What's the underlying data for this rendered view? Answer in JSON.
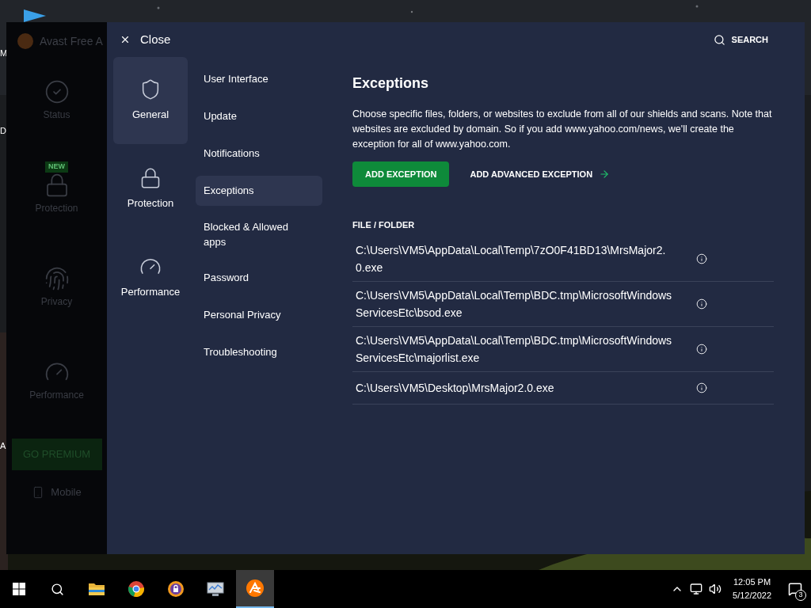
{
  "desktop": {
    "icon_labels": [
      "M",
      "D",
      "A"
    ]
  },
  "app": {
    "title": "Avast Free A",
    "sidebar": [
      {
        "kind": "status",
        "label": "Status"
      },
      {
        "kind": "protection",
        "label": "Protection",
        "badge": "NEW"
      },
      {
        "kind": "privacy",
        "label": "Privacy"
      },
      {
        "kind": "performance",
        "label": "Performance"
      }
    ],
    "premium_button": "GO PREMIUM",
    "mobile": "Mobile"
  },
  "settings": {
    "close": "Close",
    "search": "SEARCH",
    "categories": [
      {
        "kind": "general",
        "label": "General",
        "selected": true
      },
      {
        "kind": "protection",
        "label": "Protection",
        "selected": false
      },
      {
        "kind": "performance",
        "label": "Performance",
        "selected": false
      }
    ],
    "subnav": [
      {
        "label": "User Interface",
        "selected": false
      },
      {
        "label": "Update",
        "selected": false
      },
      {
        "label": "Notifications",
        "selected": false
      },
      {
        "label": "Exceptions",
        "selected": true
      },
      {
        "label": "Blocked & Allowed apps",
        "selected": false
      },
      {
        "label": "Password",
        "selected": false
      },
      {
        "label": "Personal Privacy",
        "selected": false
      },
      {
        "label": "Troubleshooting",
        "selected": false
      }
    ],
    "heading": "Exceptions",
    "description": "Choose specific files, folders, or websites to exclude from all of our shields and scans. Note that websites are excluded by domain. So if you add www.yahoo.com/news, we'll create the exception for all of www.yahoo.com.",
    "add_button": "ADD EXCEPTION",
    "advanced_link": "ADD ADVANCED EXCEPTION",
    "list_header": "FILE / FOLDER",
    "exceptions": [
      "C:\\Users\\VM5\\AppData\\Local\\Temp\\7zO0F41BD13\\MrsMajor2.0.exe",
      "C:\\Users\\VM5\\AppData\\Local\\Temp\\BDC.tmp\\MicrosoftWindowsServicesEtc\\bsod.exe",
      "C:\\Users\\VM5\\AppData\\Local\\Temp\\BDC.tmp\\MicrosoftWindowsServicesEtc\\majorlist.exe",
      "C:\\Users\\VM5\\Desktop\\MrsMajor2.0.exe"
    ]
  },
  "taskbar": {
    "apps": [
      {
        "kind": "explorer",
        "selected": false
      },
      {
        "kind": "chrome",
        "selected": false
      },
      {
        "kind": "vpn",
        "selected": false
      },
      {
        "kind": "monitor",
        "selected": false
      },
      {
        "kind": "avast",
        "selected": true
      }
    ],
    "time": "12:05 PM",
    "date": "5/12/2022",
    "notifications": "3"
  }
}
